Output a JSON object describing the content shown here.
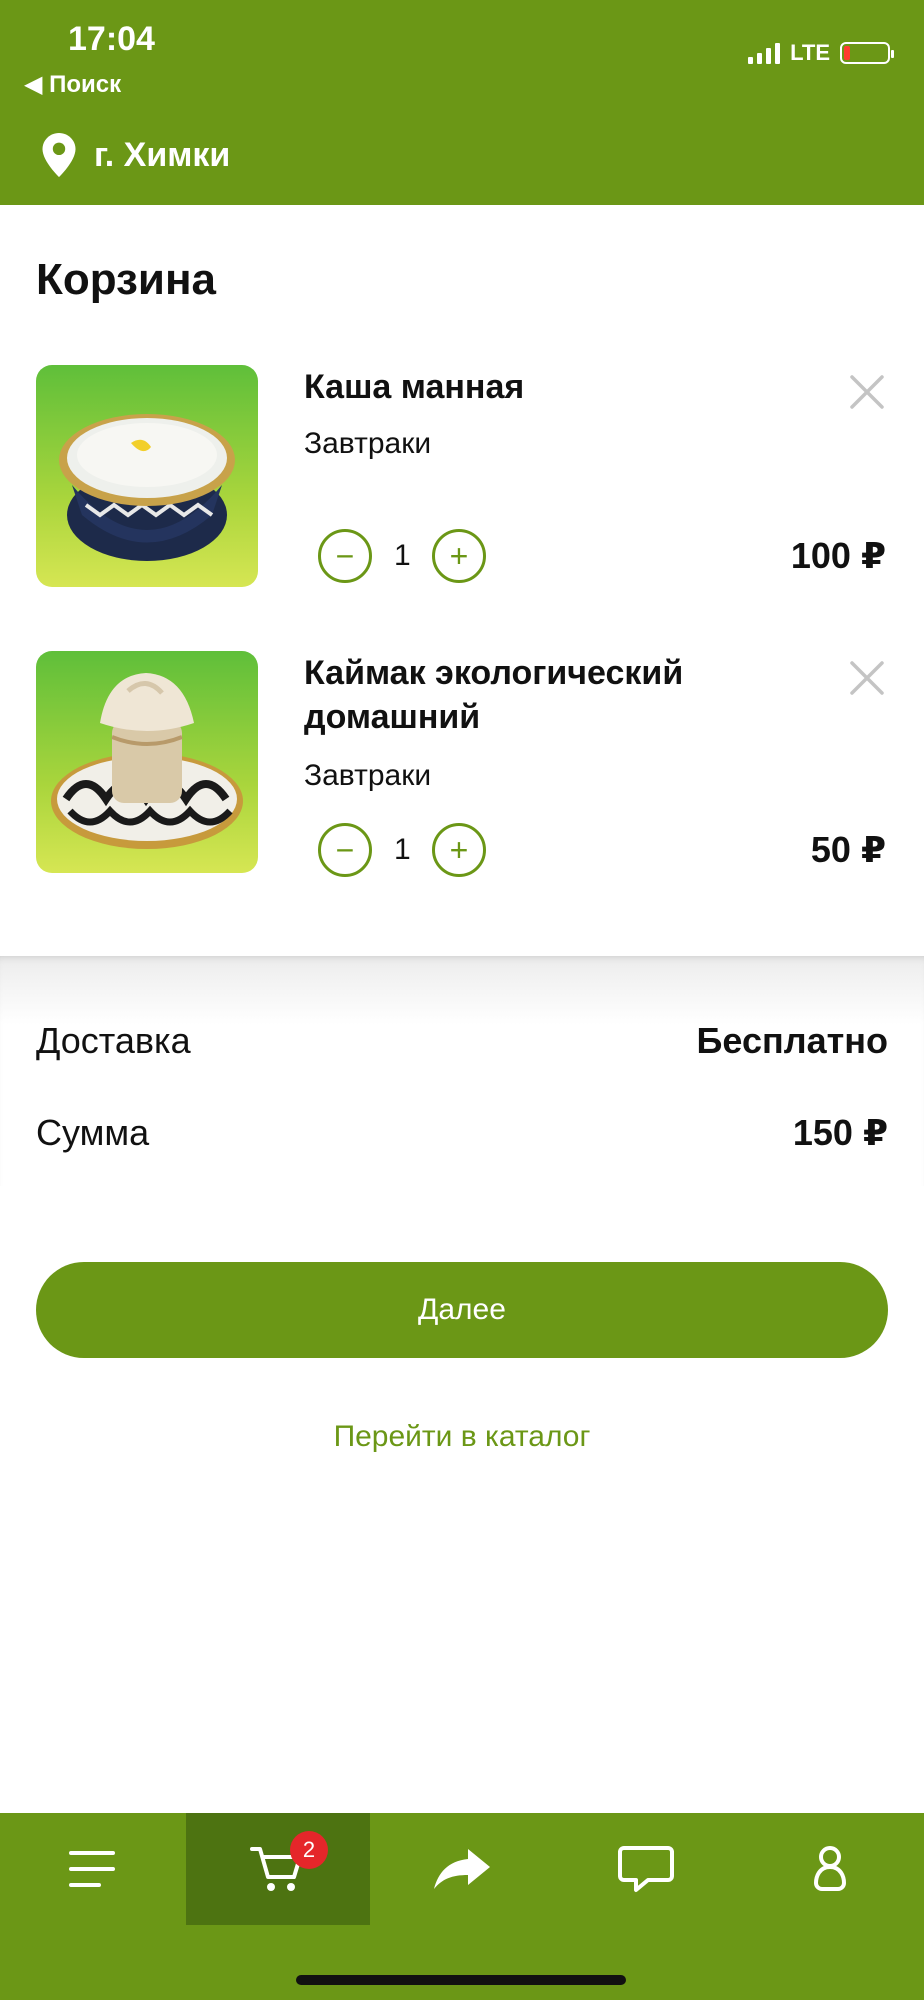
{
  "status": {
    "time": "17:04",
    "back": "◀ Поиск",
    "network": "LTE"
  },
  "header": {
    "city": "г. Химки"
  },
  "page": {
    "title": "Корзина"
  },
  "cart": {
    "items": [
      {
        "name": "Каша манная",
        "category": "Завтраки",
        "quantity": "1",
        "price": "100 ₽"
      },
      {
        "name": "Каймак экологический домашний",
        "category": "Завтраки",
        "quantity": "1",
        "price": "50 ₽"
      }
    ]
  },
  "summary": {
    "delivery_label": "Доставка",
    "delivery_value": "Бесплатно",
    "total_label": "Сумма",
    "total_value": "150 ₽"
  },
  "actions": {
    "next_label": "Далее",
    "catalog_link": "Перейти в каталог"
  },
  "tabbar": {
    "cart_badge": "2",
    "icons": [
      "menu-icon",
      "cart-icon",
      "share-icon",
      "chat-icon",
      "profile-icon"
    ]
  },
  "colors": {
    "brand": "#6b9716",
    "brand_dark": "#4d7311",
    "badge": "#e5262a"
  }
}
